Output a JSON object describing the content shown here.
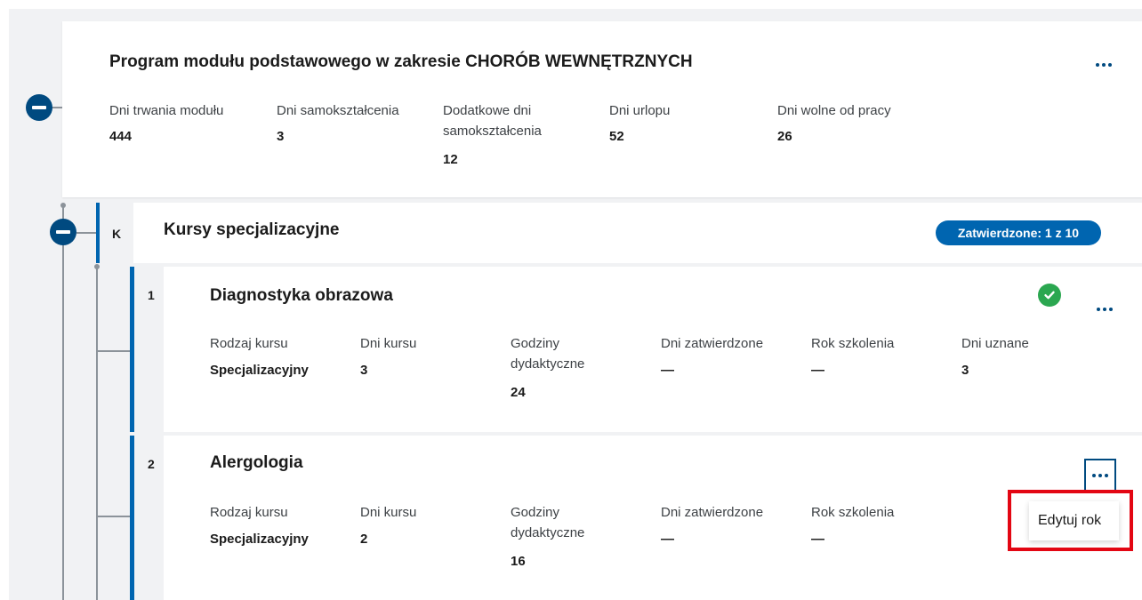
{
  "module": {
    "title": "Program modułu podstawowego w zakresie CHORÓB WEWNĘTRZNYCH",
    "stats": [
      {
        "label": "Dni trwania modułu",
        "value": "444"
      },
      {
        "label": "Dni samokształcenia",
        "value": "3"
      },
      {
        "label": "Dodatkowe dni samokształcenia",
        "value": "12"
      },
      {
        "label": "Dni urlopu",
        "value": "52"
      },
      {
        "label": "Dni wolne od pracy",
        "value": "26"
      }
    ]
  },
  "section": {
    "letter": "K",
    "title": "Kursy specjalizacyjne",
    "badge": "Zatwierdzone: 1 z 10"
  },
  "courses": [
    {
      "number": "1",
      "title": "Diagnostyka obrazowa",
      "status_icon": "check-circle-icon",
      "fields": [
        {
          "label": "Rodzaj kursu",
          "value": "Specjalizacyjny"
        },
        {
          "label": "Dni kursu",
          "value": "3"
        },
        {
          "label": "Godziny dydaktyczne",
          "value": "24"
        },
        {
          "label": "Dni zatwierdzone",
          "value": "—"
        },
        {
          "label": "Rok szkolenia",
          "value": "—"
        },
        {
          "label": "Dni uznane",
          "value": "3"
        }
      ]
    },
    {
      "number": "2",
      "title": "Alergologia",
      "fields": [
        {
          "label": "Rodzaj kursu",
          "value": "Specjalizacyjny"
        },
        {
          "label": "Dni kursu",
          "value": "2"
        },
        {
          "label": "Godziny dydaktyczne",
          "value": "16"
        },
        {
          "label": "Dni zatwierdzone",
          "value": "—"
        },
        {
          "label": "Rok szkolenia",
          "value": "—"
        }
      ],
      "menu": {
        "items": [
          "Edytuj rok"
        ]
      }
    }
  ],
  "colors": {
    "primary": "#004a80",
    "accent": "#0065b0",
    "success": "#2ba750",
    "highlight": "#e30613"
  }
}
